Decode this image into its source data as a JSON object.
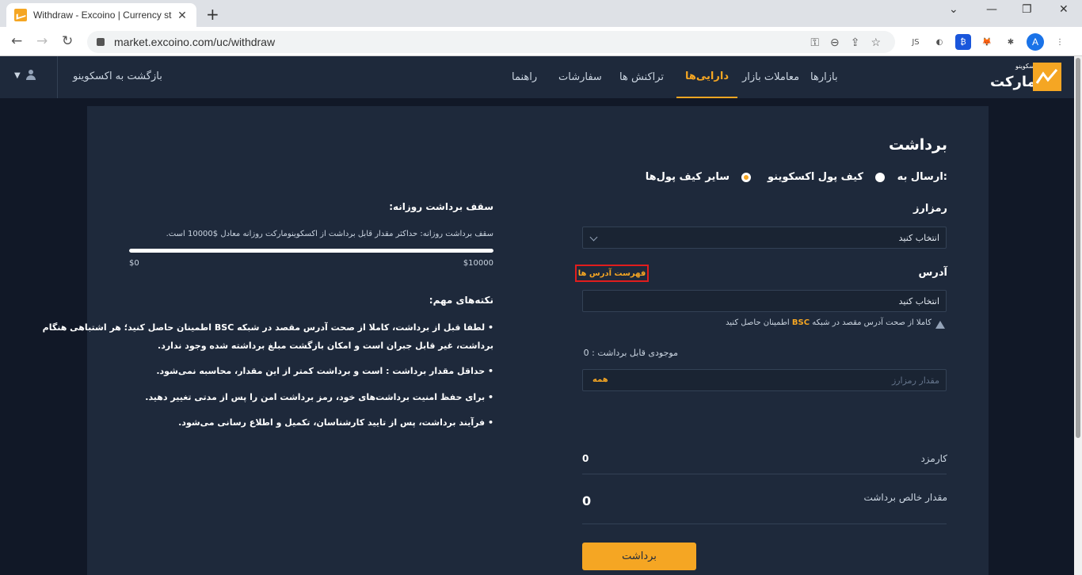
{
  "browser": {
    "tab_title": "Withdraw - Excoino | Currency st",
    "url": "market.excoino.com/uc/withdraw",
    "profile_initial": "A"
  },
  "header": {
    "logo_small": "اکسکوینو",
    "logo_big": "مارکت",
    "nav": [
      "بازارها",
      "معاملات بازار",
      "دارایی‌ها",
      "تراکنش ها",
      "سفارشات",
      "راهنما"
    ],
    "active_nav": "دارایی‌ها",
    "back_link": "بازگشت به اکسکوینو"
  },
  "withdraw": {
    "title": "برداشت",
    "send_to_label": "ارسال به:",
    "option_excoino_wallet": "کیف پول اکسکوینو",
    "option_other_wallets": "سایر کیف پول‌ها",
    "selected_option": "سایر کیف پول‌ها",
    "currency_label": "رمزارز",
    "currency_placeholder": "انتخاب کنید",
    "address_label": "آدرس",
    "address_list_button": "فهرست آدرس ها",
    "address_placeholder": "انتخاب کنید",
    "warning_pre": "کاملا از صحت آدرس مقصد در شبکه",
    "warning_network": "BSC",
    "warning_post": "اطمینان حاصل کنید",
    "balance_label": "موجودی قابل برداشت  :  0",
    "amount_placeholder": "مقدار رمزارز",
    "all_button": "همه",
    "fee_label": "کارمزد",
    "fee_value": "0",
    "net_label": "مقدار خالص برداشت",
    "net_value": "0",
    "submit_label": "برداشت"
  },
  "daily_limit": {
    "title": "سقف برداشت روزانه:",
    "description": "سقف برداشت روزانه: حداکثر مقدار قابل برداشت از اکسکوینومارکت روزانه معادل $10000 است.",
    "min_label": "$0",
    "max_label": "$10000",
    "used_fraction": 1.0
  },
  "notes": {
    "title": "نکته‌های مهم:",
    "items": [
      "• لطفا قبل از برداشت، کاملا از صحت آدرس مقصد در شبکه BSC اطمینان حاصل کنید؛ هر اشتباهی هنگام",
      "برداشت، غیر قابل جبران است و امکان بازگشت مبلغ برداشته شده وجود ندارد.",
      "• حداقل مقدار برداشت  :  است و برداشت کمتر از این مقدار، محاسبه نمی‌شود.",
      "• برای حفظ امنیت برداشت‌های خود، رمز برداشت امن را پس از مدتی تغییر دهید.",
      "• فرآیند برداشت، پس از تایید کارشناسان، تکمیل و اطلاع رسانی می‌شود."
    ]
  },
  "colors": {
    "accent": "#f5a623",
    "panel": "#1e293b",
    "background": "#111827",
    "highlight_border": "#e11d1d"
  }
}
